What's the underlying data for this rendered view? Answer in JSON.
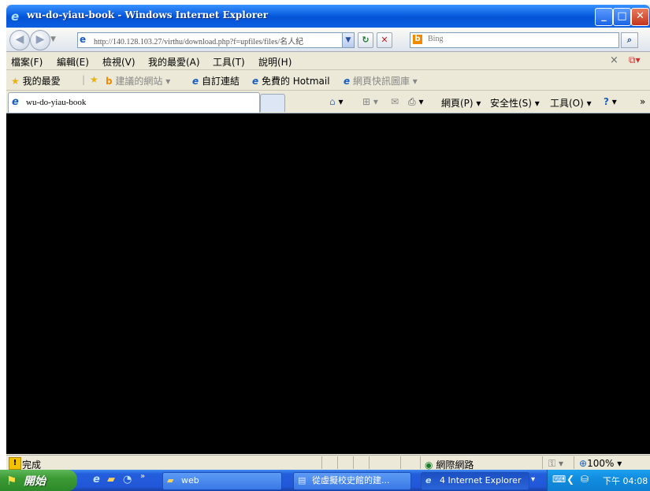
{
  "window": {
    "title": "wu-do-yiau-book - Windows Internet Explorer",
    "minimize_glyph": "_",
    "maximize_glyph": "□",
    "close_glyph": "✕"
  },
  "nav": {
    "back_glyph": "◀",
    "forward_glyph": "▶",
    "address": "http://140.128.103.27/virthu/download.php?f=upfiles/files/名人紀",
    "refresh_glyph": "↻",
    "stop_glyph": "✕",
    "search_placeholder": "Bing",
    "search_glyph": "⌕"
  },
  "menu": {
    "items": [
      "檔案(F)",
      "編輯(E)",
      "檢視(V)",
      "我的最愛(A)",
      "工具(T)",
      "說明(H)"
    ]
  },
  "favorites": {
    "label": "我的最愛",
    "suggested": "建議的網站 ▾",
    "custom_links": "自訂連結",
    "hotmail": "免費的 Hotmail",
    "web_slice": "網頁快訊圖庫 ▾"
  },
  "tab": {
    "label": "wu-do-yiau-book"
  },
  "commands": {
    "home": "▾",
    "feeds": "▾",
    "print": "▾",
    "page": "網頁(P) ▾",
    "safety": "安全性(S) ▾",
    "tools": "工具(O) ▾",
    "help": "▾",
    "more": "»"
  },
  "status": {
    "text": "完成",
    "zone": "網際網路",
    "zoom": "100%"
  },
  "taskbar": {
    "start_label": "開始",
    "buttons": [
      {
        "label": "web"
      },
      {
        "label": "從虛擬校史館的建..."
      },
      {
        "label": "4 Internet Explorer"
      }
    ],
    "clock": "下午 04:08"
  },
  "colors": {
    "titlebar": "#0a5fe0",
    "content_bg": "#000000",
    "chrome": "#ECE9D8",
    "taskbar": "#245edb",
    "start": "#3c9a34"
  }
}
